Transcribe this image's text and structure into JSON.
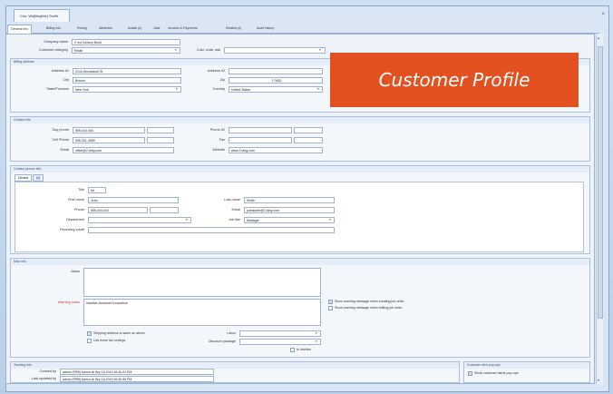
{
  "window": {
    "doc_tab": "Cus. Wo[illegible] Smith",
    "close_glyph": "×"
  },
  "tabs": [
    "General info",
    "Billing info",
    "Pricing",
    "Attributes",
    "Avatar (n)",
    "Jobs",
    "Invoices & Payments",
    "Related (n)",
    "Audit history"
  ],
  "general": {
    "company_name_label": "Company name",
    "company_name_value": "2 Ind Century Build",
    "customer_category_label": "Customer category",
    "customer_category_value": "Retail",
    "cust_code_label": "Cust. code. ask",
    "cust_code_value": ""
  },
  "billing": {
    "title": "Billing address",
    "address1_label": "Address #1",
    "address1_value": "2244 Woodstock St",
    "address2_label": "Address #2",
    "address2_value": "",
    "city_label": "City",
    "city_value": "Boston",
    "zip_label": "Zip",
    "zip_value": "T 0620",
    "state_label": "State/Province",
    "state_value": "New York",
    "country_label": "Country",
    "country_value": "United States"
  },
  "contact": {
    "title": "Contact info",
    "dayphone_label": "Day phone",
    "dayphone_value": "555-444-444",
    "phone2_label": "Phone #2",
    "phone2_value": "",
    "cellphone_label": "Cell Phone",
    "cellphone_value": "555-201-4550",
    "fax_label": "Fax",
    "fax_value": "",
    "email_label": "Email",
    "email_value": "office@2-bing.com",
    "website_label": "Website",
    "website_value": "www.2-bing.com"
  },
  "contact_person": {
    "title": "Contact person info",
    "tabs": [
      "Default",
      "(2)"
    ],
    "title_label": "Title",
    "title_value": "Mr.",
    "first_name_label": "First name",
    "first_name_value": "John",
    "last_name_label": "Last name",
    "last_name_value": "Smith",
    "phone_label": "Phone",
    "phone_value": "555-444-444",
    "email_label": "Email",
    "email_value": "johnsmith@2-bing.com",
    "department_label": "Department",
    "department_value": "",
    "job_title_label": "Job title",
    "job_title_value": "Manager",
    "receiving_label": "Receiving credit",
    "receiving_value": ""
  },
  "misc": {
    "title": "Misc info",
    "notes_label": "Notes",
    "notes_value": "",
    "warning_label": "Warning notes",
    "warning_value": "Inactive customer's incentive",
    "chk_warning_creating": "Show warning message when creating job order",
    "chk_warning_editing": "Show warning message when editing job order",
    "chk_shipping": "Shipping address is same as above",
    "chk_tax": "Use these tax settings",
    "labor_label": "Labor",
    "discount_label": "Discount package",
    "chk_inactive": "Is Inactive"
  },
  "tracking": {
    "title": "Tracking info",
    "created_label": "Created by",
    "created_value": "admin (PRB) Admin at Sep 15,2019 06:30:22 PM",
    "updated_label": "Last updated by",
    "updated_value": "admin (PRB) Admin at Sep 15,2019 06:30:36 PM",
    "alert_title": "Customer alert pop-ups",
    "alert_chk": "Show customer alerts pop-ups"
  },
  "banner": {
    "text": "Customer Profile"
  },
  "colors": {
    "banner": "#e2511f",
    "warning_label": "#d4421f"
  }
}
